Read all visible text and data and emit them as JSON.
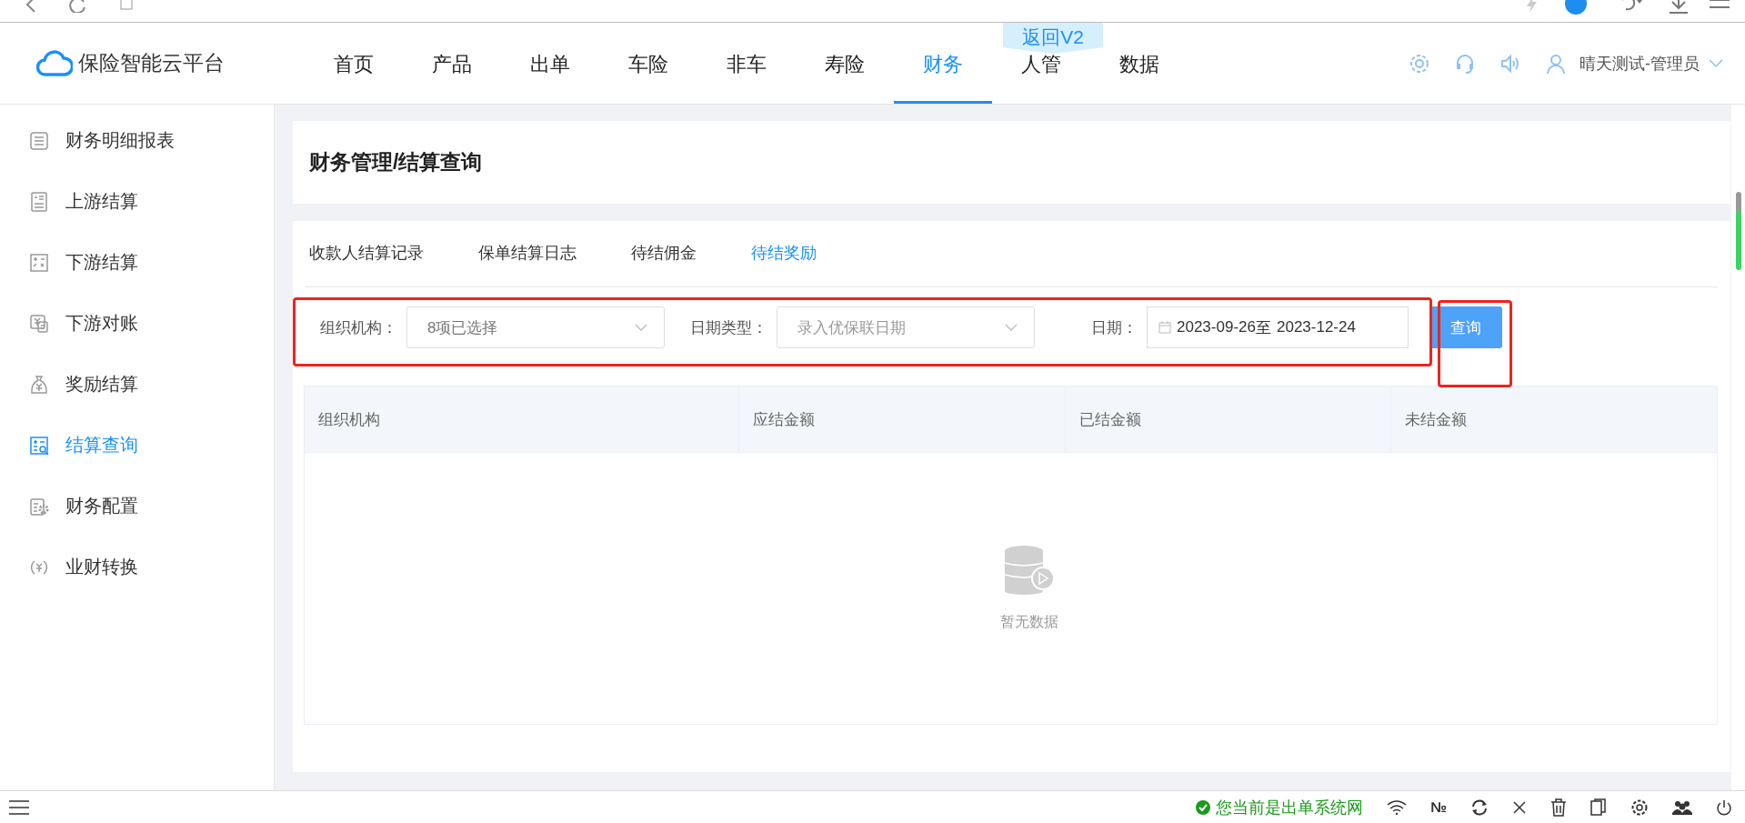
{
  "app": {
    "logo": "保险智能云平台",
    "user": "晴天测试-管理员"
  },
  "nav": [
    {
      "label": "首页",
      "selected": false
    },
    {
      "label": "产品",
      "selected": false
    },
    {
      "label": "出单",
      "selected": false
    },
    {
      "label": "车险",
      "selected": false
    },
    {
      "label": "非车",
      "selected": false
    },
    {
      "label": "寿险",
      "selected": false
    },
    {
      "label": "财务",
      "selected": true
    },
    {
      "label": "人管",
      "selected": false
    },
    {
      "label": "数据",
      "selected": false
    }
  ],
  "overlay_badge": "返回V2",
  "sidebar": [
    {
      "label": "财务明细报表",
      "kind": "list",
      "selected": false
    },
    {
      "label": "上游结算",
      "kind": "bill",
      "selected": false
    },
    {
      "label": "下游结算",
      "kind": "calc",
      "selected": false
    },
    {
      "label": "下游对账",
      "kind": "recon",
      "selected": false
    },
    {
      "label": "奖励结算",
      "kind": "bag",
      "selected": false
    },
    {
      "label": "结算查询",
      "kind": "query",
      "selected": true
    },
    {
      "label": "财务配置",
      "kind": "config",
      "selected": false
    },
    {
      "label": "业财转换",
      "kind": "convert",
      "selected": false
    }
  ],
  "page_title": "财务管理/结算查询",
  "tabs": [
    {
      "label": "收款人结算记录",
      "selected": false
    },
    {
      "label": "保单结算日志",
      "selected": false
    },
    {
      "label": "待结佣金",
      "selected": false
    },
    {
      "label": "待结奖励",
      "selected": true
    }
  ],
  "filters": {
    "org": {
      "label": "组织机构：",
      "value": "8项已选择"
    },
    "date_type": {
      "label": "日期类型：",
      "placeholder": "录入优保联日期"
    },
    "date": {
      "label": "日期：",
      "start": "2023-09-26",
      "separator": "至",
      "end": "2023-12-24"
    },
    "query_button": "查询"
  },
  "table": {
    "columns": [
      "组织机构",
      "应结金额",
      "已结金额",
      "未结金额"
    ],
    "empty_text": "暂无数据"
  },
  "status_bar": {
    "message": "您当前是出单系统网",
    "symbol": "№"
  }
}
